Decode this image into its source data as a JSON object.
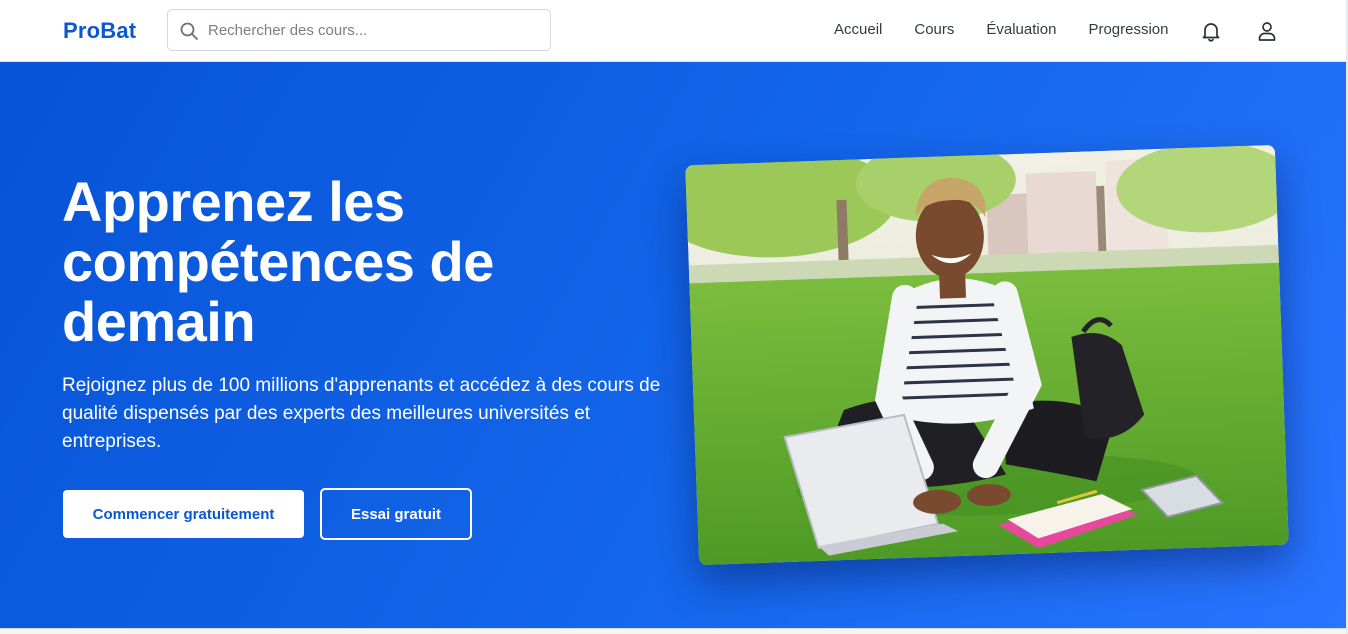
{
  "brand": {
    "name": "ProBat",
    "color": "#0b57d0"
  },
  "search": {
    "placeholder": "Rechercher des cours..."
  },
  "nav": {
    "links": [
      "Accueil",
      "Cours",
      "Évaluation",
      "Progression"
    ],
    "icons": {
      "notifications": "bell-icon",
      "account": "user-icon",
      "search": "search-icon"
    }
  },
  "hero": {
    "title": "Apprenez les compétences de demain",
    "subtitle": "Rejoignez plus de 100 millions d'apprenants et accédez à des cours de qualité dispensés par des experts des meilleures universités et entreprises.",
    "primary_cta": "Commencer gratuitement",
    "secondary_cta": "Essai gratuit",
    "colors": {
      "gradient_start": "#0753d6",
      "gradient_end": "#2a74ff"
    }
  }
}
